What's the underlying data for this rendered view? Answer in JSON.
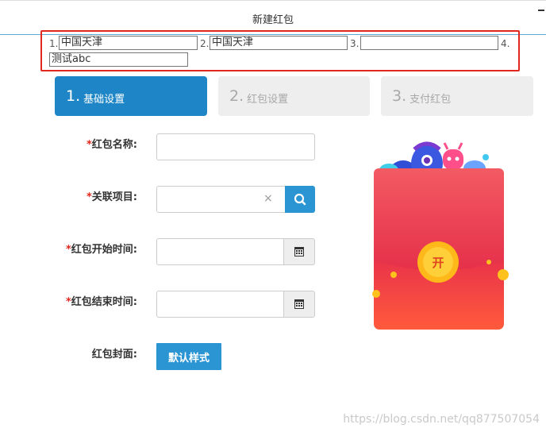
{
  "window": {
    "title": "新建红包"
  },
  "inputs": {
    "label1": "1.",
    "value1": "中国天津",
    "label2": "2.",
    "value2": "中国天津",
    "label3": "3.",
    "value3": "",
    "label4": "4.",
    "value4": "测试abc"
  },
  "steps": [
    {
      "num": "1.",
      "label": "基础设置",
      "active": true
    },
    {
      "num": "2.",
      "label": "红包设置",
      "active": false
    },
    {
      "num": "3.",
      "label": "支付红包",
      "active": false
    }
  ],
  "form": {
    "required_mark": "*",
    "name_label": "红包名称:",
    "project_label": "关联项目:",
    "clear_glyph": "×",
    "start_label": "红包开始时间:",
    "end_label": "红包结束时间:",
    "cover_label": "红包封面:",
    "default_style_button": "默认样式"
  },
  "envelope": {
    "open_char": "开"
  },
  "watermark": "https://blog.csdn.net/qq877507054",
  "colors": {
    "primary": "#2a95d2",
    "active_step": "#1e86c6",
    "required": "#e0281e",
    "highlight_box": "#e0281e"
  }
}
